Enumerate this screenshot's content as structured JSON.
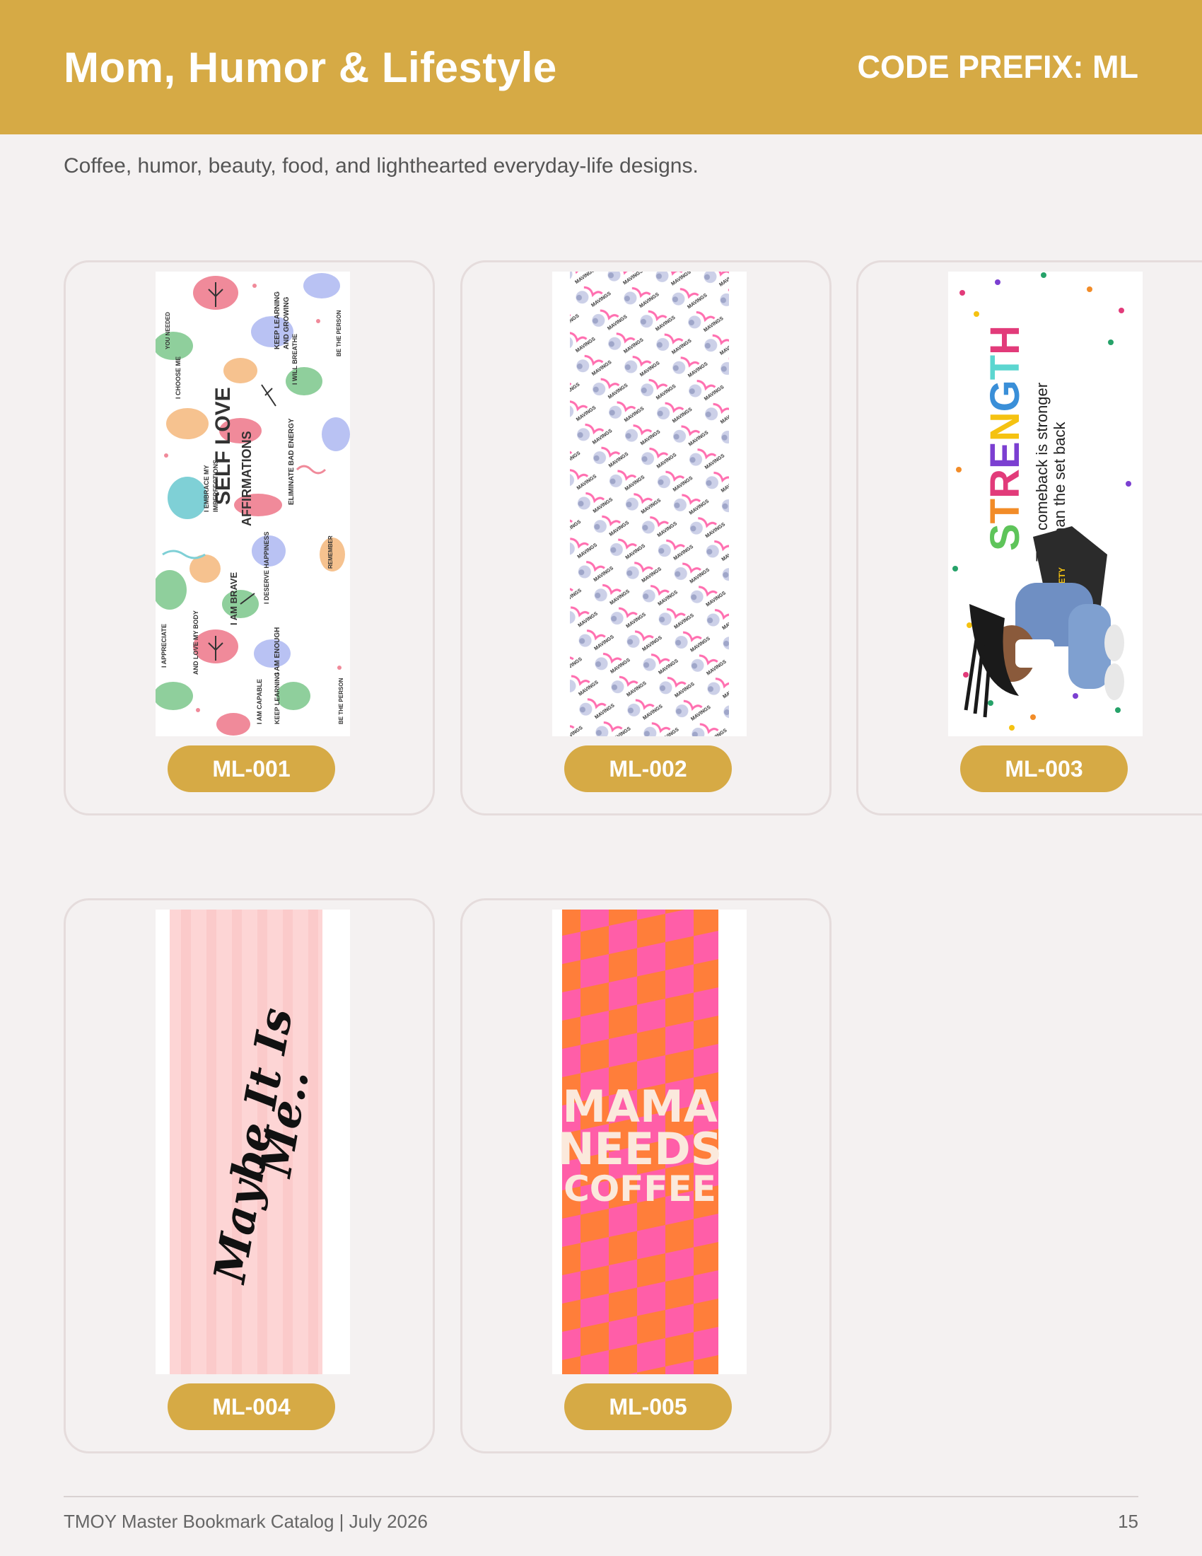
{
  "header": {
    "title": "Mom, Humor & Lifestyle",
    "code_prefix": "CODE PREFIX: ML"
  },
  "subtitle": "Coffee, humor, beauty, food, and lighthearted everyday-life designs.",
  "items": [
    {
      "code": "ML-001"
    },
    {
      "code": "ML-002"
    },
    {
      "code": "ML-003"
    },
    {
      "code": "ML-004"
    },
    {
      "code": "ML-005"
    }
  ],
  "artwork_text": {
    "ml001": [
      "SELF LOVE AFFIRMATIONS",
      "I AM BRAVE",
      "KEEP LEARNING AND GROWING",
      "I EMBRACE MY IMPERFECTIONS",
      "I AM ENOUGH",
      "ELIMINATE BAD ENERGY",
      "I WILL BREATHE",
      "I APPRECIATE AND LOVE MY BODY",
      "I CHOOSE ME",
      "I DESERVE HAPPINESS"
    ],
    "ml002": "MAVINGS",
    "ml003_title": "STRENGTH",
    "ml003_line1": "The comeback is stronger",
    "ml003_line2": "than the set back",
    "ml003_bag": "ANXIETY",
    "ml004_line1": "Maybe It Is",
    "ml004_line2": "Me..",
    "ml005_lines": [
      "MAMA",
      "NEEDS",
      "COFFEE"
    ]
  },
  "footer": {
    "left": "TMOY Master Bookmark Catalog | July 2026",
    "page_number": "15"
  },
  "colors": {
    "accent": "#d6aa45",
    "background": "#f4f1f1",
    "card_border": "#e5dcdc"
  }
}
